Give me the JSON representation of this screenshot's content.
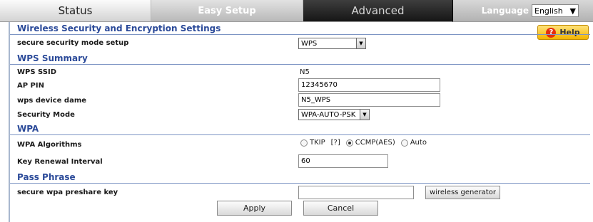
{
  "nav": {
    "tabs": [
      {
        "label": "Status"
      },
      {
        "label": "Easy Setup"
      },
      {
        "label": "Advanced"
      }
    ],
    "language_label": "Language",
    "language_value": "English"
  },
  "help_label": "Help",
  "sections": {
    "wireless": "Wireless Security and Encryption Settings",
    "wps": "WPS Summary",
    "wpa": "WPA",
    "pass": "Pass Phrase"
  },
  "form": {
    "secure_mode_label": "secure security mode setup",
    "secure_mode_value": "WPS",
    "wps_ssid_label": "WPS SSID",
    "wps_ssid_value": "N5",
    "ap_pin_label": "AP PIN",
    "ap_pin_value": "12345670",
    "device_name_label": "wps device dame",
    "device_name_value": "N5_WPS",
    "security_mode_label": "Security Mode",
    "security_mode_value": "WPA-AUTO-PSK",
    "wpa_alg_label": "WPA Algorithms",
    "wpa_alg_options": [
      "TKIP",
      "[?]",
      "CCMP(AES)",
      "Auto"
    ],
    "wpa_alg_selected": "CCMP(AES)",
    "key_renewal_label": "Key Renewal Interval",
    "key_renewal_value": "60",
    "preshare_label": "secure wpa preshare key",
    "preshare_value": "",
    "generator_label": "wireless generator"
  },
  "actions": {
    "apply": "Apply",
    "cancel": "Cancel"
  }
}
